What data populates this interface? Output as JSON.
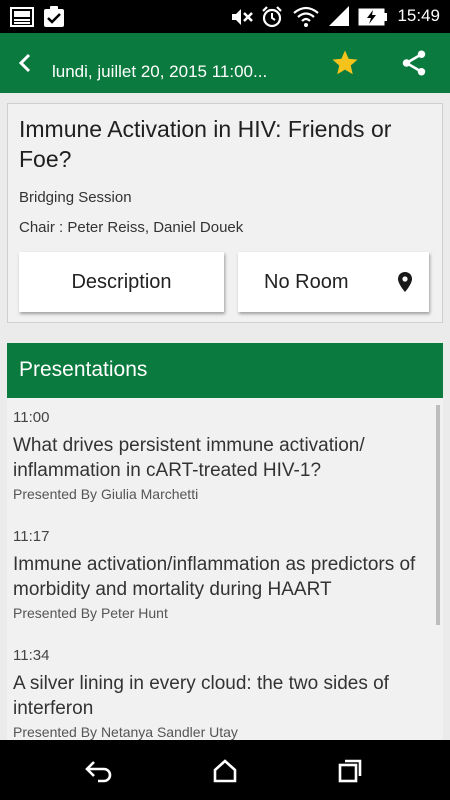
{
  "status_bar": {
    "time": "15:49"
  },
  "app_bar": {
    "title": "lundi, juillet 20, 2015 11:00...",
    "favorite_color": "#F6C31C"
  },
  "session": {
    "title": "Immune Activation in HIV: Friends or Foe?",
    "type": "Bridging Session",
    "chair": "Chair : Peter Reiss, Daniel Douek",
    "description_label": "Description",
    "room_label": "No Room"
  },
  "presentations": {
    "header": "Presentations",
    "items": [
      {
        "time": "11:00",
        "title": "What drives persistent immune activation/ inflammation in cART-treated HIV-1?",
        "presenter": "Presented By Giulia Marchetti"
      },
      {
        "time": "11:17",
        "title": "Immune activation/inflammation as predictors of morbidity and mortality during HAART",
        "presenter": "Presented By Peter Hunt"
      },
      {
        "time": "11:34",
        "title": "A silver lining in every cloud: the two sides of interferon",
        "presenter": "Presented By Netanya Sandler Utay"
      }
    ]
  },
  "colors": {
    "brand_green": "#0B7A3E",
    "card_background": "#F1F1F1",
    "page_background": "#EBEBEB"
  },
  "icons": {
    "status_left": [
      "image-icon",
      "clipboard-check-icon"
    ],
    "status_right": [
      "mute-icon",
      "alarm-icon",
      "wifi-icon",
      "signal-icon",
      "battery-charging-icon"
    ],
    "app_bar": [
      "back-arrow-icon",
      "star-icon",
      "share-icon"
    ],
    "room": "location-pin-icon",
    "nav": [
      "nav-back-icon",
      "nav-home-icon",
      "nav-recents-icon"
    ]
  }
}
